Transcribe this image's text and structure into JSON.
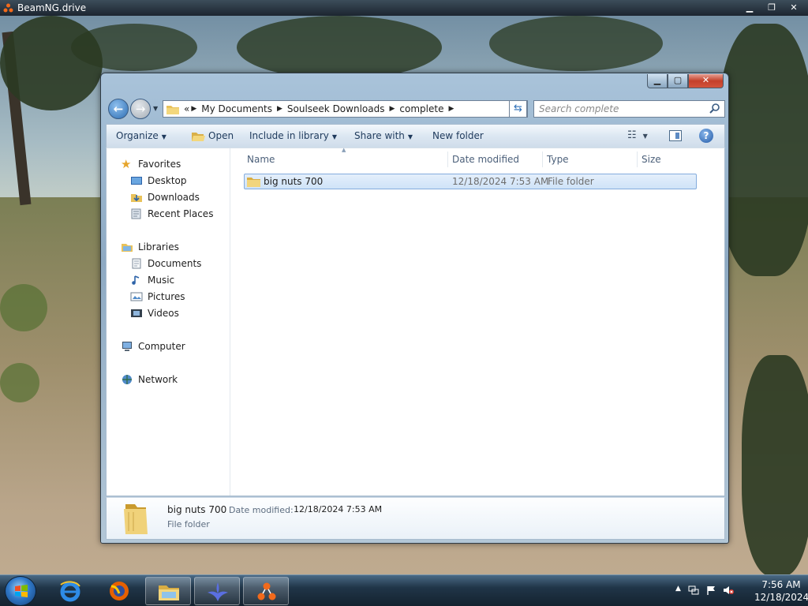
{
  "game_window": {
    "title": "BeamNG.drive",
    "minimize": "▁",
    "restore": "❐",
    "close": "✕"
  },
  "explorer": {
    "controls": {
      "minimize": "▁",
      "maximize": "▢",
      "close": "✕"
    },
    "nav": {
      "back": "←",
      "forward": "→"
    },
    "address": {
      "overflow": "«",
      "crumbs": [
        "My Documents",
        "Soulseek Downloads",
        "complete"
      ]
    },
    "search": {
      "placeholder": "Search complete"
    },
    "toolbar": {
      "organize": "Organize",
      "open": "Open",
      "include": "Include in library",
      "share": "Share with",
      "new_folder": "New folder",
      "help": "?"
    },
    "nav_pane": {
      "favorites": {
        "label": "Favorites",
        "items": [
          "Desktop",
          "Downloads",
          "Recent Places"
        ]
      },
      "libraries": {
        "label": "Libraries",
        "items": [
          "Documents",
          "Music",
          "Pictures",
          "Videos"
        ]
      },
      "computer": "Computer",
      "network": "Network"
    },
    "columns": {
      "name": "Name",
      "date": "Date modified",
      "type": "Type",
      "size": "Size"
    },
    "rows": [
      {
        "name": "big nuts 700",
        "date": "12/18/2024 7:53 AM",
        "type": "File folder",
        "size": ""
      }
    ],
    "details": {
      "name": "big nuts 700",
      "date_label": "Date modified:",
      "date_value": "12/18/2024 7:53 AM",
      "type": "File folder"
    }
  },
  "taskbar": {
    "clock_time": "7:56 AM",
    "clock_date": "12/18/2024"
  },
  "colors": {
    "selection": "#cfe3f8",
    "selection_border": "#84acdd",
    "link": "#1e3a5c",
    "taskbar": "#14222f"
  }
}
